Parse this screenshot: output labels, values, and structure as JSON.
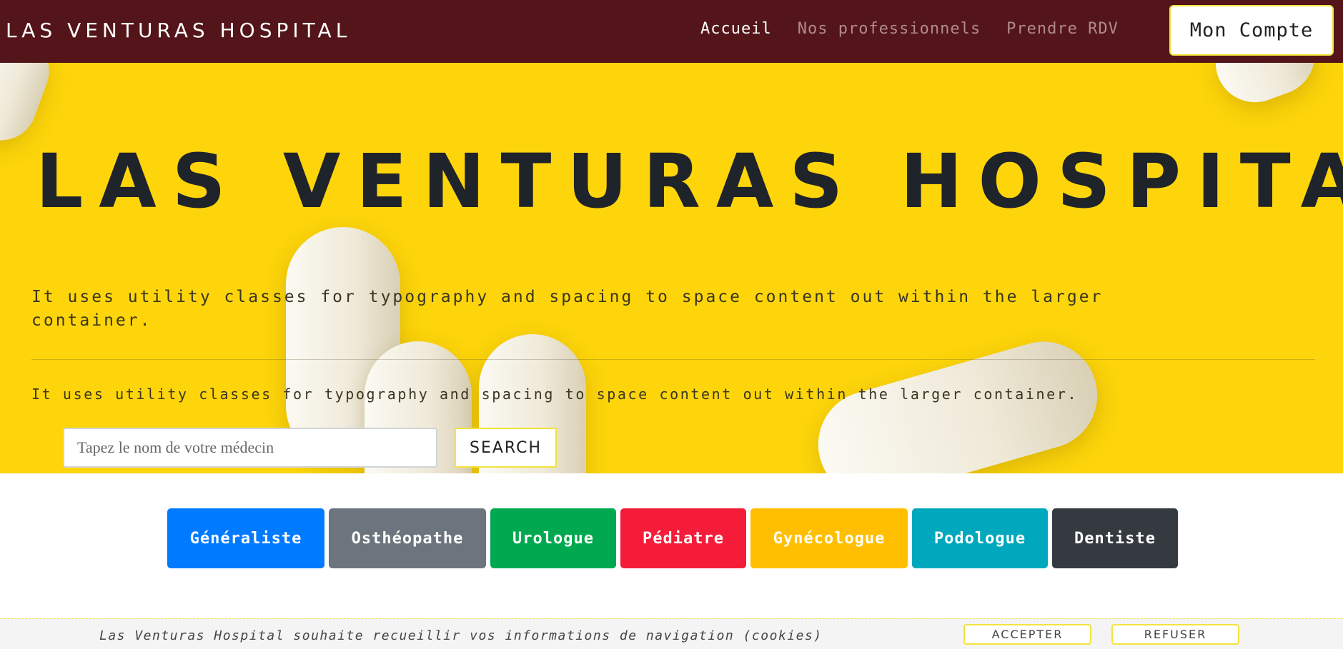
{
  "navbar": {
    "brand": "LAS VENTURAS HOSPITAL",
    "links": [
      {
        "label": "Accueil",
        "active": true
      },
      {
        "label": "Nos professionnels",
        "active": false
      },
      {
        "label": "Prendre RDV",
        "active": false
      }
    ],
    "account_label": "Mon Compte",
    "background_color": "#531519"
  },
  "hero": {
    "title": "LAS VENTURAS HOSPITAL",
    "lead": "It uses utility classes for typography and spacing to space content out within the larger container.",
    "sub": "It uses utility classes for typography and spacing to space content out within the larger container.",
    "search": {
      "placeholder": "Tapez le nom de votre médecin",
      "button_label": "SEARCH"
    },
    "background_color": "#fdd50a"
  },
  "categories": [
    {
      "label": "Généraliste",
      "color": "#007bff"
    },
    {
      "label": "Osthéopathe",
      "color": "#6c757d"
    },
    {
      "label": "Urologue",
      "color": "#00a94f"
    },
    {
      "label": "Pédiatre",
      "color": "#f51c3a"
    },
    {
      "label": "Gynécologue",
      "color": "#ffbf00"
    },
    {
      "label": "Podologue",
      "color": "#00a8bd"
    },
    {
      "label": "Dentiste",
      "color": "#343a40"
    }
  ],
  "cookie_bar": {
    "message": "Las Venturas Hospital souhaite recueillir vos informations de navigation (cookies)",
    "accept_label": "ACCEPTER",
    "refuse_label": "REFUSER"
  }
}
